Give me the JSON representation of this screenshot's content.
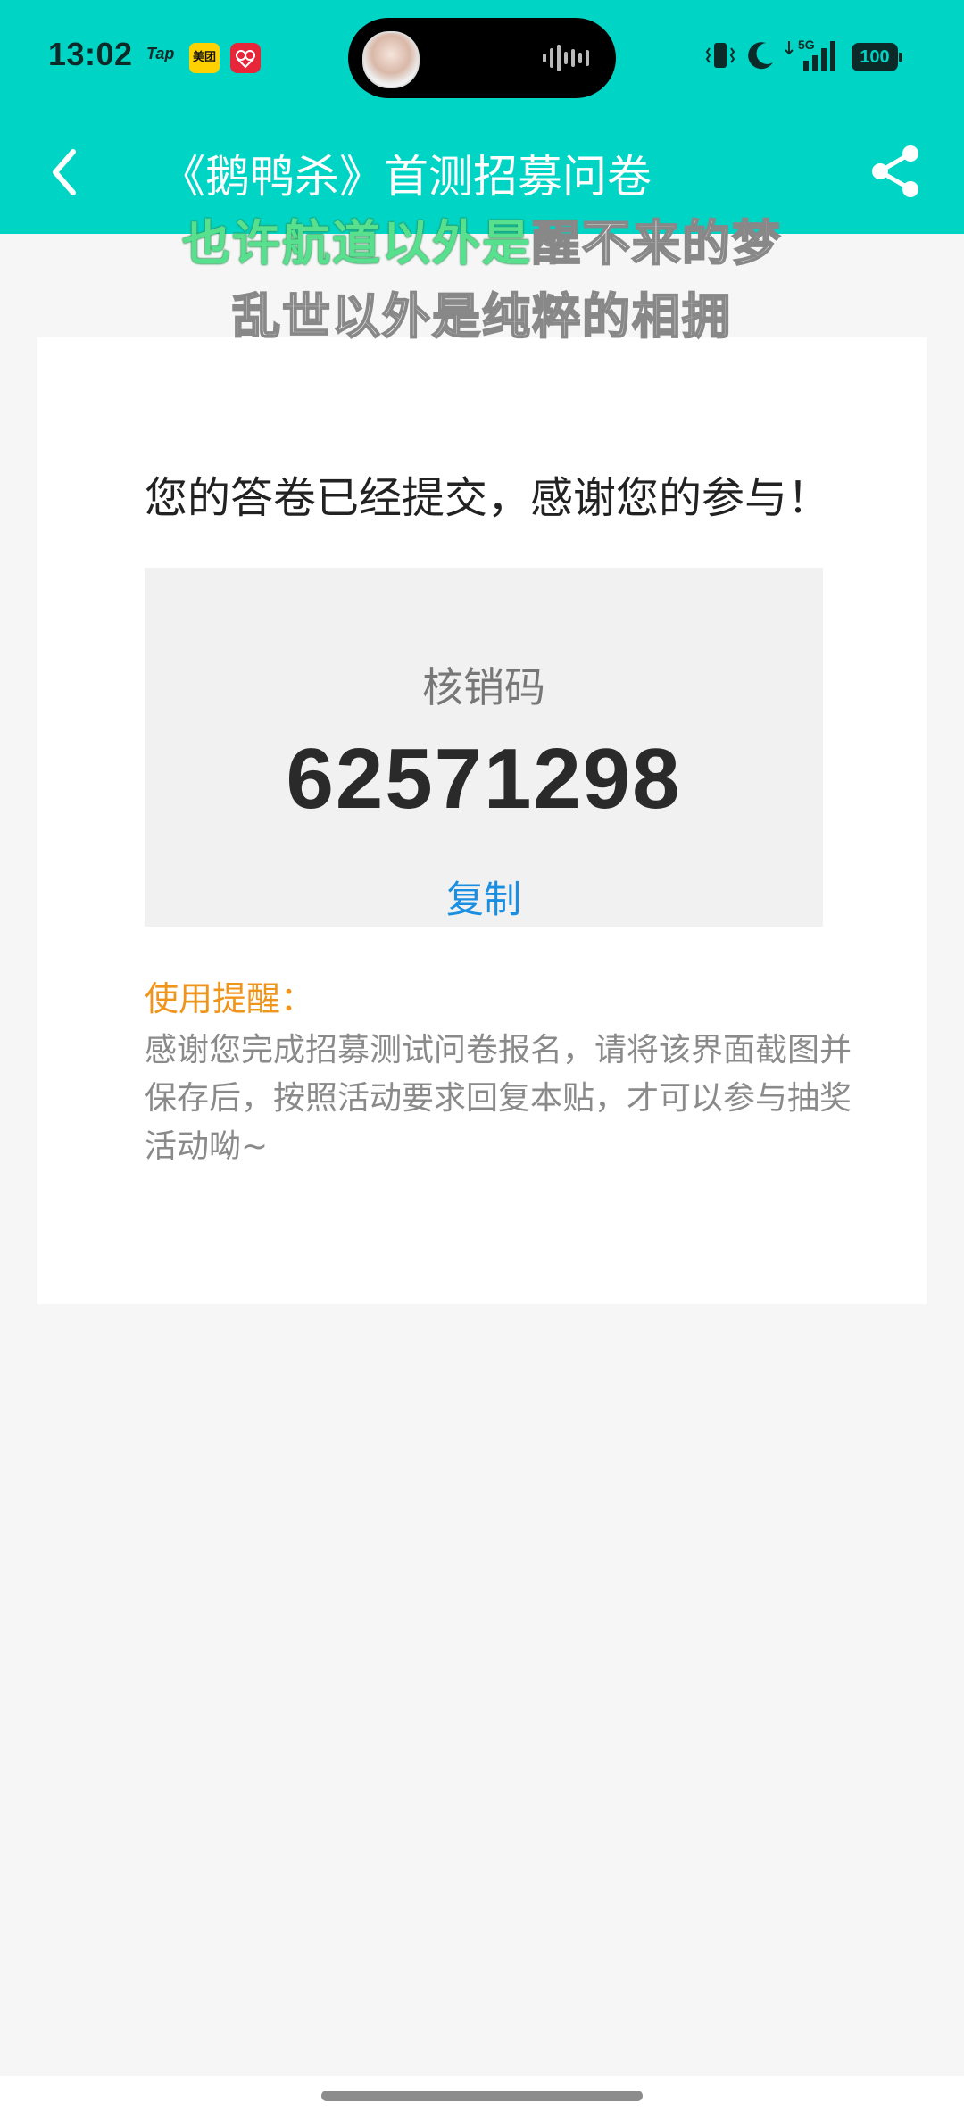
{
  "status_bar": {
    "time": "13:02",
    "app_tap": "Tap",
    "app_meituan": "美团",
    "signal_label": "5G",
    "battery": "100"
  },
  "nav": {
    "title": "《鹅鸭杀》首测招募问卷"
  },
  "lyrics": {
    "line1_sung": "也许航道以外是",
    "line1_unsung": "醒不来的梦",
    "line2": "乱世以外是纯粹的相拥"
  },
  "card": {
    "thanks": "您的答卷已经提交，感谢您的参与！",
    "code_label": "核销码",
    "code_value": "62571298",
    "copy_label": "复制",
    "tip_label": "使用提醒：",
    "tip_text": "感谢您完成招募测试问卷报名，请将该界面截图并保存后，按照活动要求回复本贴，才可以参与抽奖活动呦~"
  },
  "colors": {
    "header": "#00d4c4",
    "link": "#1a8ee0",
    "tip": "#f0951c"
  }
}
